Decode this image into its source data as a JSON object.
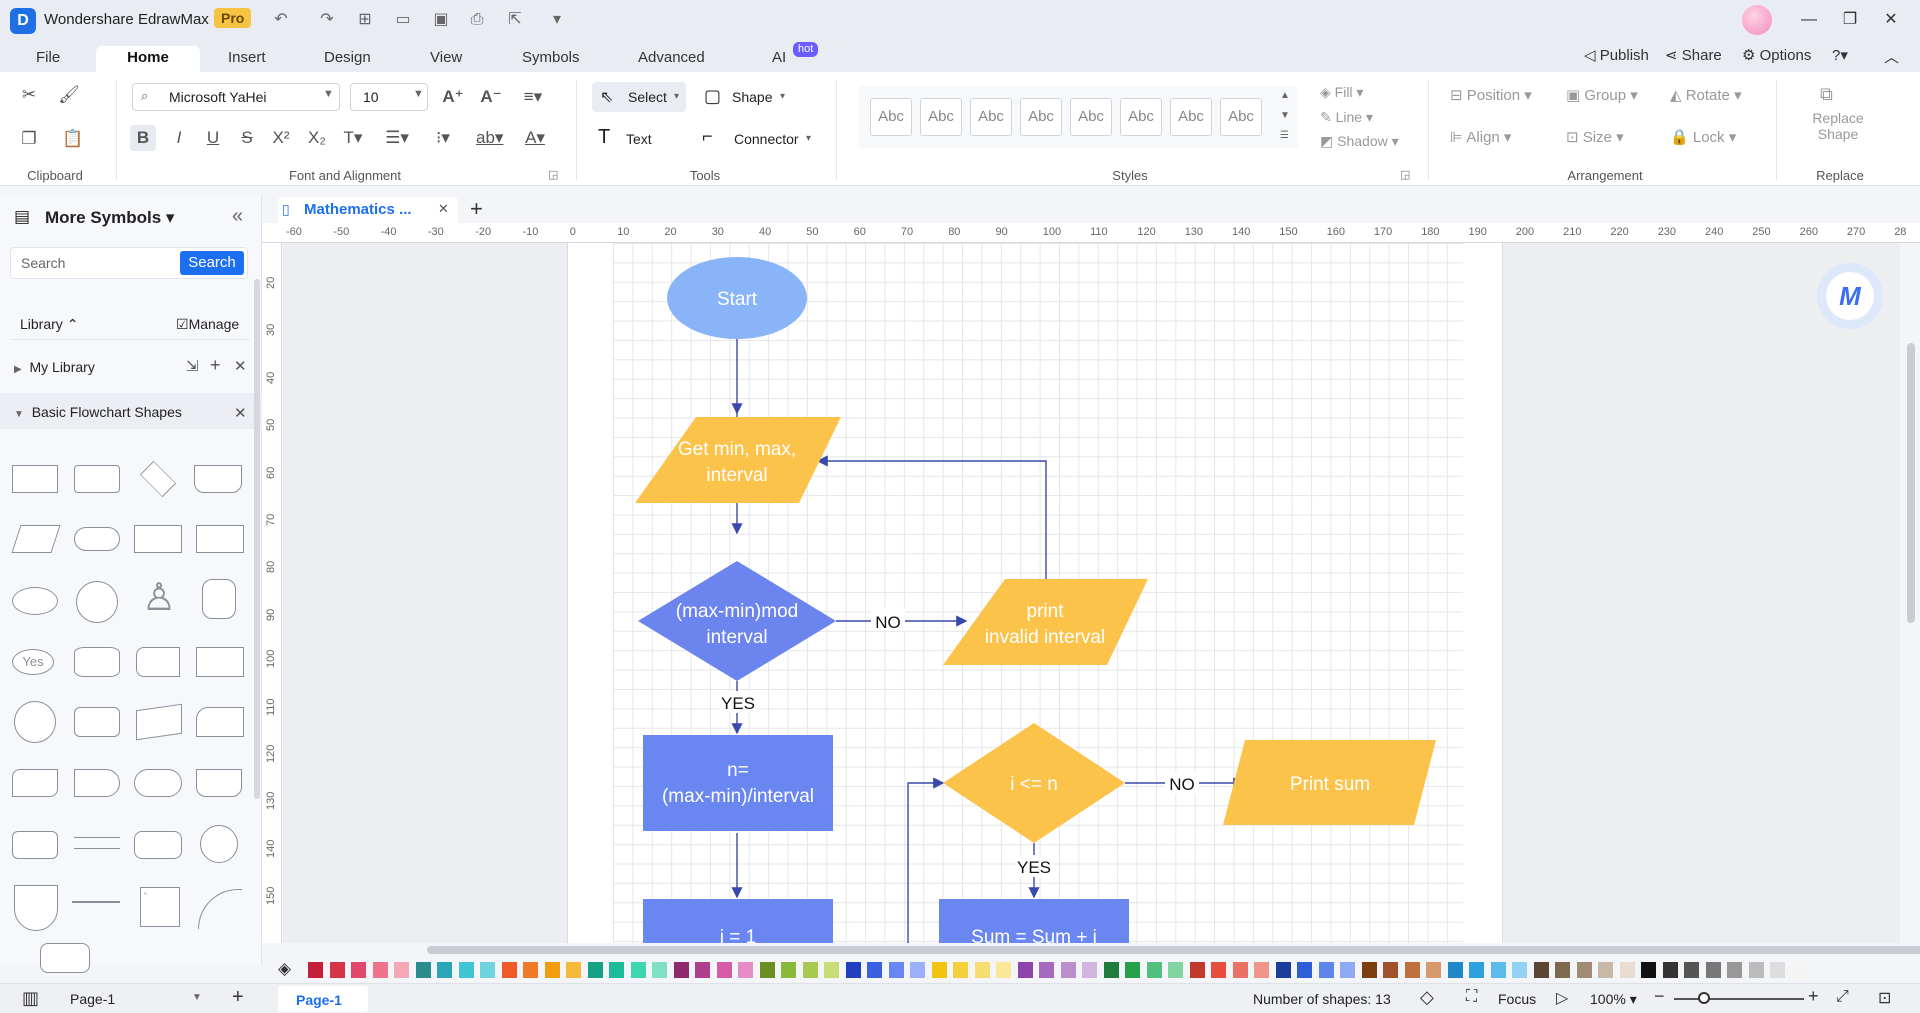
{
  "app": {
    "name": "Wondershare EdrawMax",
    "badge": "Pro"
  },
  "menu_tabs": [
    "File",
    "Home",
    "Insert",
    "Design",
    "View",
    "Symbols",
    "Advanced",
    "AI"
  ],
  "ai_badge": "hot",
  "top_actions": {
    "publish": "Publish",
    "share": "Share",
    "options": "Options"
  },
  "ribbon": {
    "clipboard_label": "Clipboard",
    "font_name": "Microsoft YaHei",
    "font_size": "10",
    "font_group_label": "Font and Alignment",
    "select": "Select",
    "shape": "Shape",
    "text": "Text",
    "connector": "Connector",
    "tools_label": "Tools",
    "style_swatch": "Abc",
    "fill": "Fill",
    "line": "Line",
    "shadow": "Shadow",
    "styles_label": "Styles",
    "position": "Position",
    "group": "Group",
    "rotate": "Rotate",
    "align": "Align",
    "size": "Size",
    "lock": "Lock",
    "arrangement_label": "Arrangement",
    "replace_shape_1": "Replace",
    "replace_shape_2": "Shape",
    "replace_label": "Replace"
  },
  "left_panel": {
    "title": "More Symbols",
    "search_placeholder": "Search",
    "search_button": "Search",
    "library": "Library",
    "manage": "Manage",
    "my_library": "My Library",
    "section": "Basic Flowchart Shapes",
    "yes_shape": "Yes"
  },
  "document_tab": "Mathematics ...",
  "ruler_h": [
    "-60",
    "-50",
    "-40",
    "-30",
    "-20",
    "-10",
    "0",
    "10",
    "20",
    "30",
    "40",
    "50",
    "60",
    "70",
    "80",
    "90",
    "100",
    "110",
    "120",
    "130",
    "140",
    "150",
    "160",
    "170",
    "180",
    "190",
    "200",
    "210",
    "220",
    "230",
    "240",
    "250",
    "260",
    "270",
    "28"
  ],
  "ruler_v": [
    "20",
    "30",
    "40",
    "50",
    "60",
    "70",
    "80",
    "90",
    "100",
    "110",
    "120",
    "130",
    "140",
    "150"
  ],
  "flowchart": {
    "start": "Start",
    "get_1": "Get min, max,",
    "get_2": "interval",
    "mod_1": "(max-min)mod",
    "mod_2": "interval",
    "print_1": "print",
    "print_2": "invalid interval",
    "n_1": "n=",
    "n_2": "(max-min)/interval",
    "cond": "i <= n",
    "print_sum": "Print sum",
    "bottom_left": "i = 1",
    "bottom_right": "Sum = Sum + i",
    "no_1": "NO",
    "yes_1": "YES",
    "no_2": "NO",
    "yes_2": "YES"
  },
  "colors": {
    "blue_light": "#8ab4f8",
    "yellow": "#fcc34a",
    "purple": "#6b84ee",
    "rect_blue": "#6a86f1"
  },
  "status": {
    "page_select": "Page-1",
    "page_tab": "Page-1",
    "shapes_count": "Number of shapes: 13",
    "focus": "Focus",
    "zoom": "100%"
  }
}
